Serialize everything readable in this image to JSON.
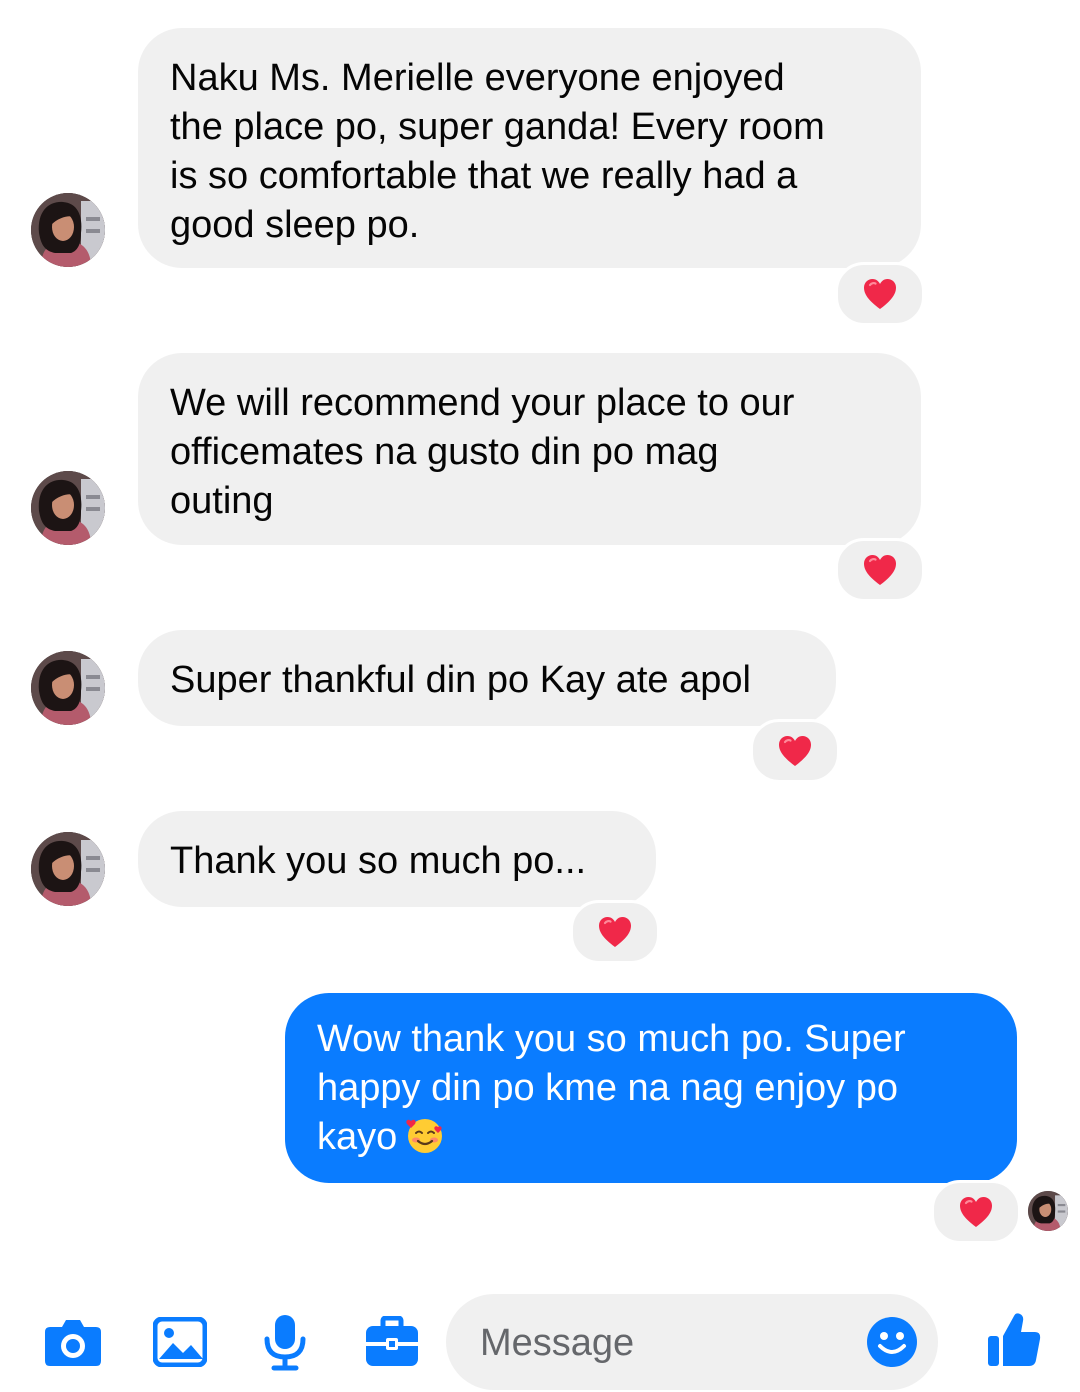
{
  "colors": {
    "accent": "#0a7cff",
    "incoming_bubble": "#f0f0f0",
    "reaction_heart": "#f02849"
  },
  "messages": [
    {
      "sender": "them",
      "lines": [
        "Naku Ms. Merielle everyone enjoyed",
        "the place po, super ganda! Every room",
        "is so comfortable that we really had a",
        "good sleep po."
      ],
      "reaction": "heart"
    },
    {
      "sender": "them",
      "lines": [
        "We will recommend your place to our",
        "officemates na gusto din po mag",
        "outing"
      ],
      "reaction": "heart"
    },
    {
      "sender": "them",
      "lines": [
        "Super thankful din po Kay ate apol"
      ],
      "reaction": "heart"
    },
    {
      "sender": "them",
      "lines": [
        "Thank you so much po..."
      ],
      "reaction": "heart"
    },
    {
      "sender": "me",
      "lines": [
        "Wow thank you so much po. Super",
        "happy din po kme na nag enjoy po",
        "kayo"
      ],
      "emoji": "smiling-face-with-hearts",
      "reaction": "heart",
      "seen_by_avatar": true
    }
  ],
  "composer": {
    "placeholder": "Message",
    "tools": [
      "camera-icon",
      "photo-icon",
      "microphone-icon",
      "briefcase-icon"
    ],
    "emoji_button": "smiley-icon",
    "send_button": "thumbs-up-icon"
  }
}
